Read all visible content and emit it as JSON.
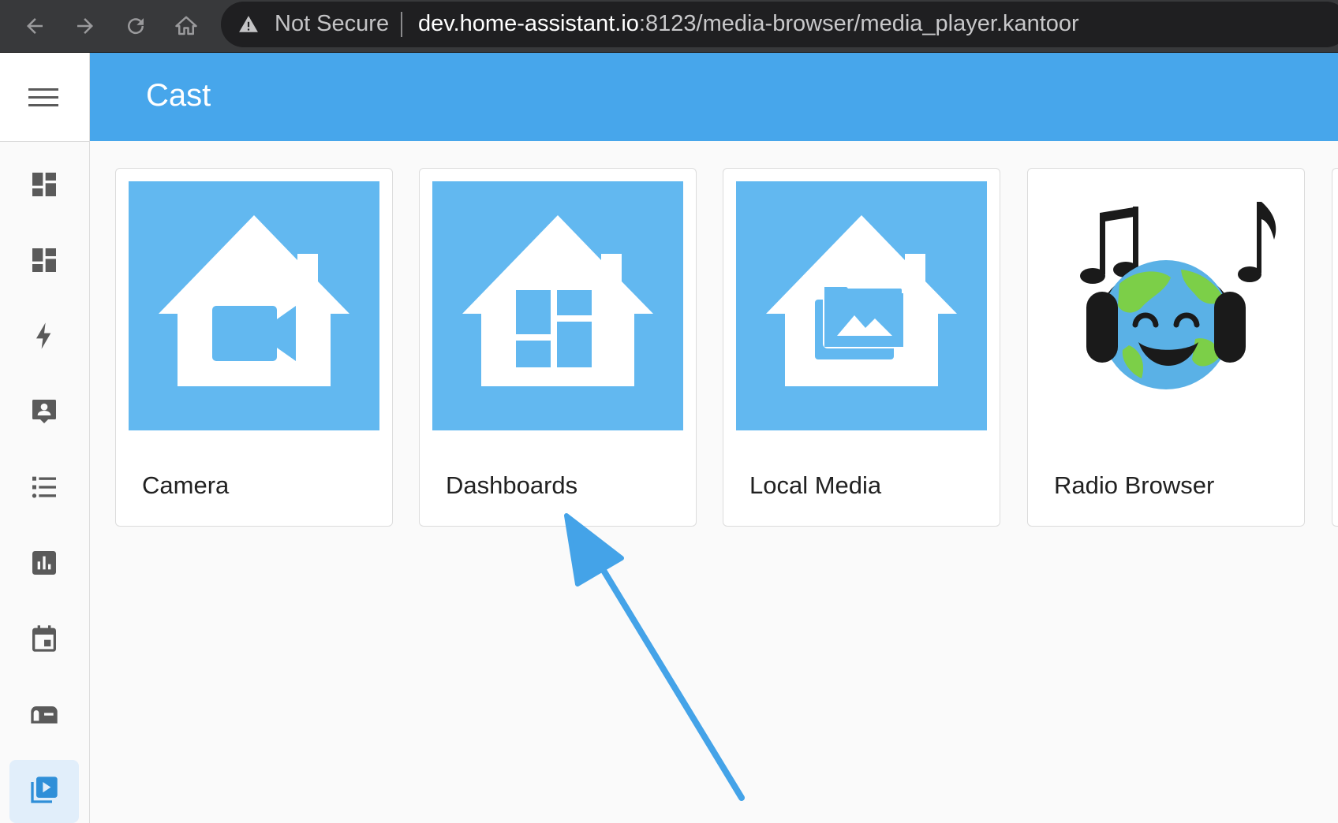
{
  "browser": {
    "security_label": "Not Secure",
    "url_host": "dev.home-assistant.io",
    "url_rest": ":8123/media-browser/media_player.kantoor",
    "icons": [
      "back-arrow-icon",
      "forward-arrow-icon",
      "reload-icon",
      "home-icon",
      "warning-icon"
    ]
  },
  "header": {
    "title": "Cast"
  },
  "sidebar": {
    "items": [
      {
        "name": "overview",
        "icon": "dashboard-icon"
      },
      {
        "name": "dashboard",
        "icon": "dashboard-icon"
      },
      {
        "name": "energy",
        "icon": "lightning-icon"
      },
      {
        "name": "map-people",
        "icon": "account-box-icon"
      },
      {
        "name": "logbook",
        "icon": "format-list-icon"
      },
      {
        "name": "history",
        "icon": "bar-chart-icon"
      },
      {
        "name": "calendar",
        "icon": "calendar-icon"
      },
      {
        "name": "mailbox",
        "icon": "mailbox-icon"
      },
      {
        "name": "media",
        "icon": "play-box-multiple-icon",
        "active": true
      }
    ]
  },
  "cards": [
    {
      "label": "Camera",
      "icon": "camera-house-icon"
    },
    {
      "label": "Dashboards",
      "icon": "dashboards-house-icon"
    },
    {
      "label": "Local Media",
      "icon": "local-media-house-icon"
    },
    {
      "label": "Radio Browser",
      "icon": "radio-browser-globe-icon"
    }
  ],
  "colors": {
    "accent": "#47a6eb",
    "tile": "#62b8f0",
    "arrow": "#44a3e8",
    "icon_gray": "#5a5a5a"
  }
}
